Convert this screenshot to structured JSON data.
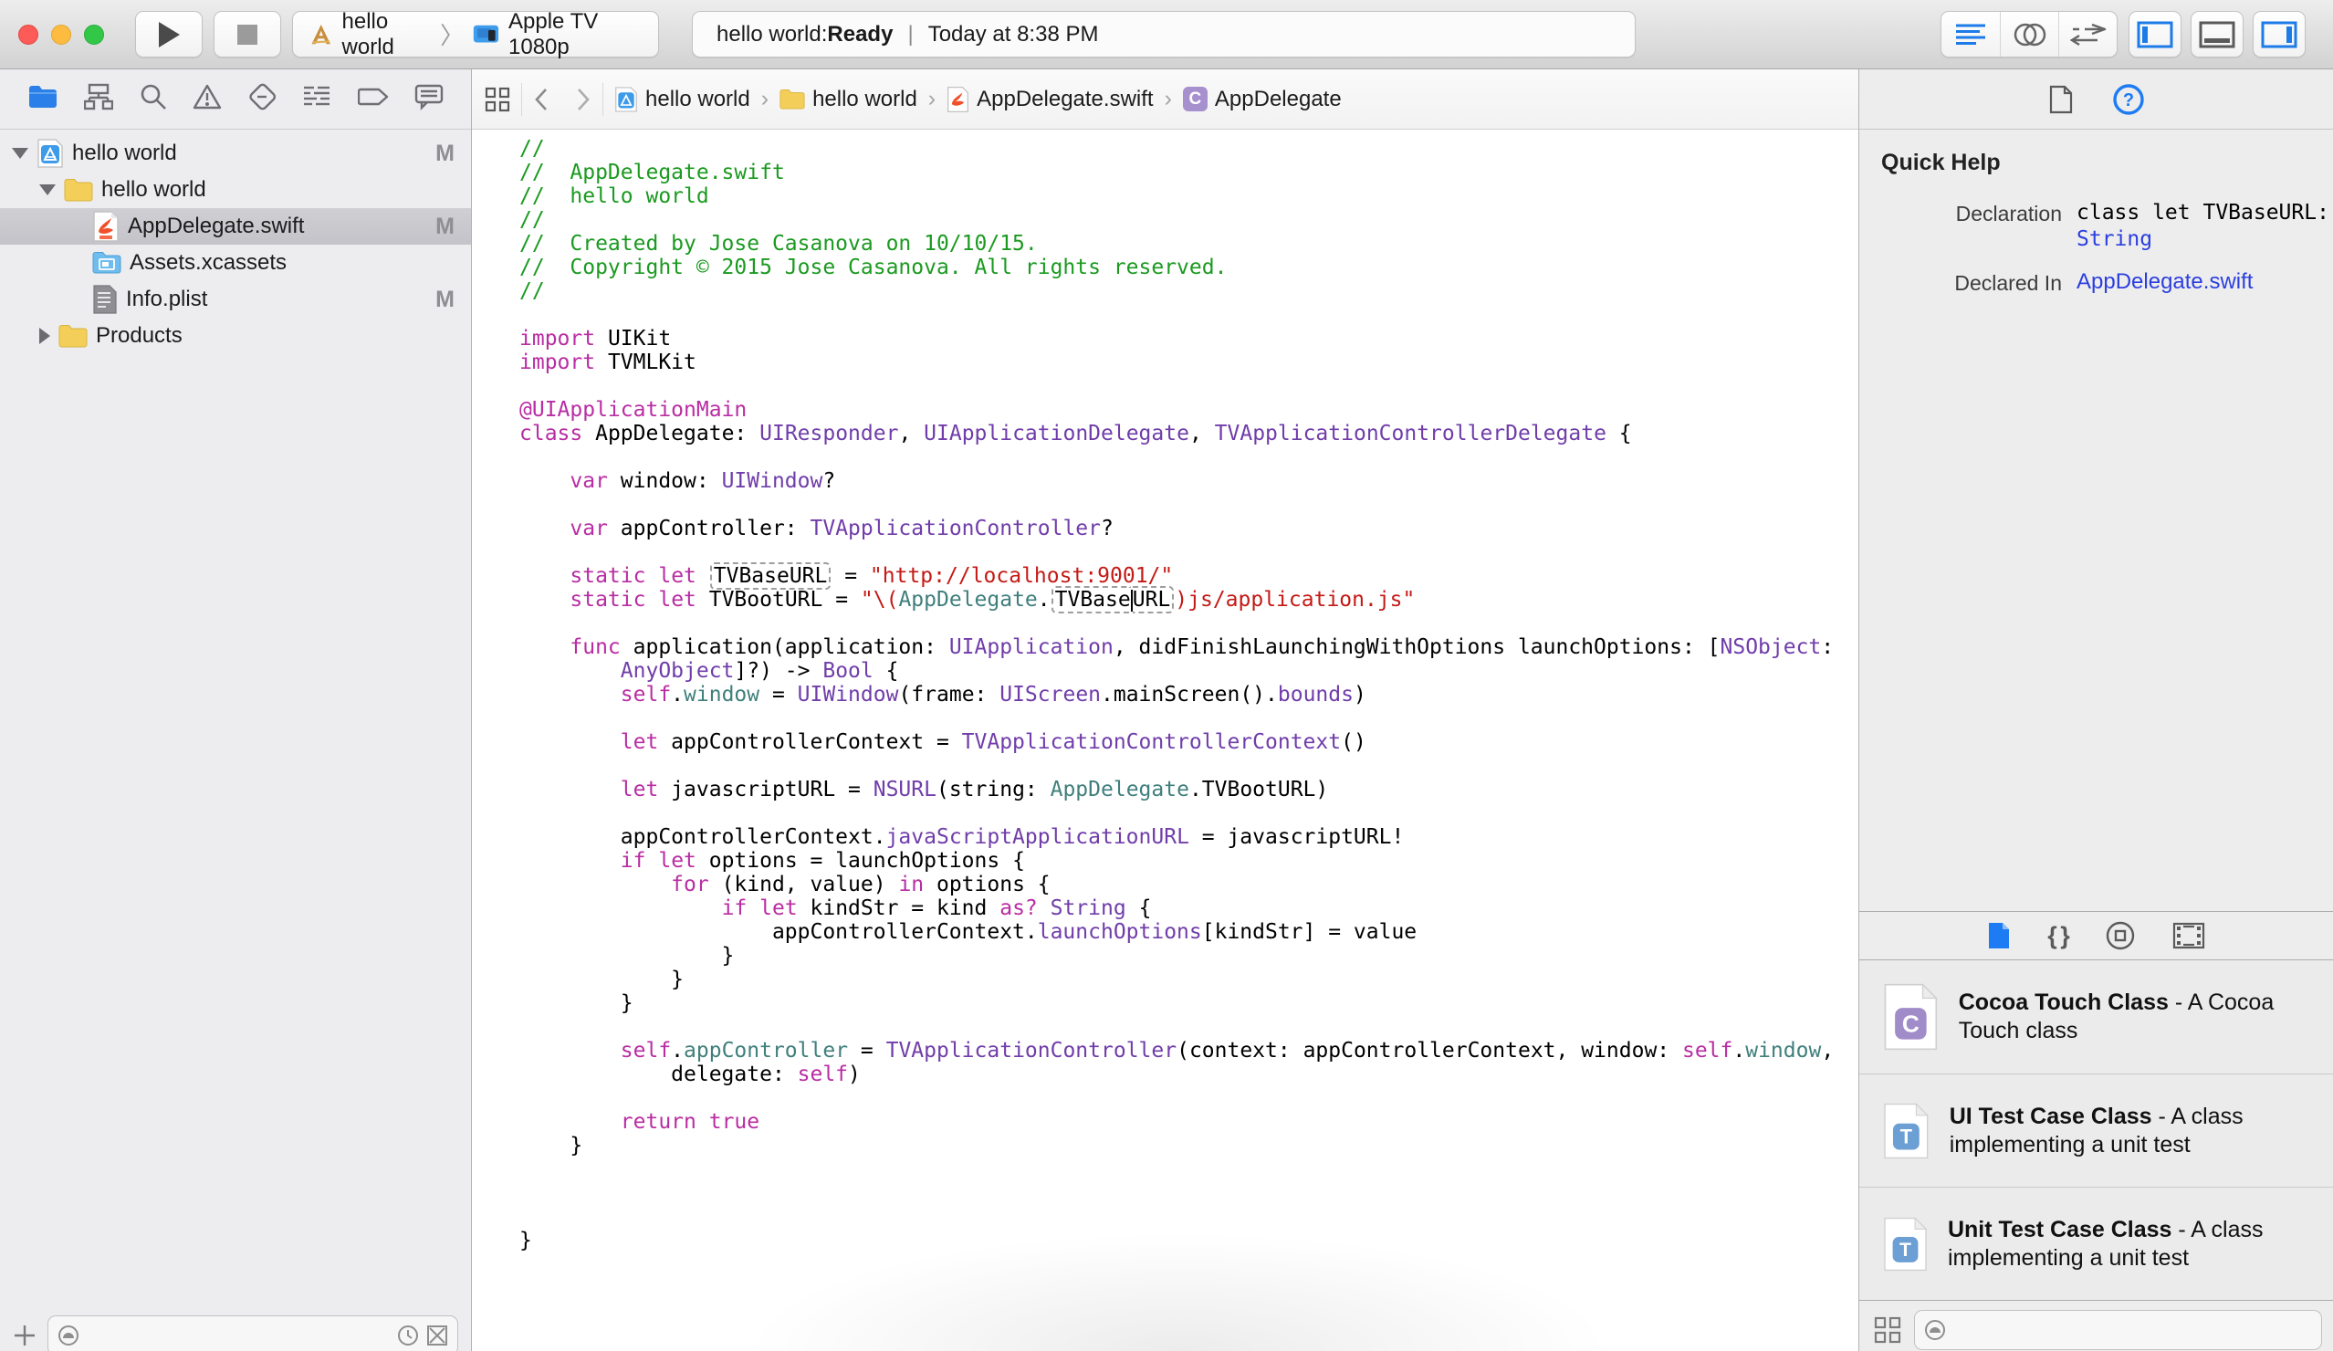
{
  "toolbar": {
    "scheme": {
      "project": "hello world",
      "sep": "〉",
      "device": "Apple TV 1080p"
    },
    "status": {
      "prefix": "hello world: ",
      "state": "Ready",
      "sep": "|",
      "time": "Today at 8:38 PM"
    }
  },
  "colors": {
    "traffic_red": "#FC5B57",
    "traffic_yellow": "#FDBC40",
    "traffic_green": "#33C748",
    "accent_blue": "#1D7BE8",
    "keyword": "#B92DA3",
    "comment": "#1B9A20",
    "string": "#C41A16",
    "type_purple": "#703DAA",
    "project_teal": "#3F7F7C"
  },
  "navigator": {
    "rows": [
      {
        "label": "hello world",
        "badge": "M",
        "icon": "project"
      },
      {
        "label": "hello world",
        "badge": "",
        "icon": "folder"
      },
      {
        "label": "AppDelegate.swift",
        "badge": "M",
        "icon": "swift"
      },
      {
        "label": "Assets.xcassets",
        "badge": "",
        "icon": "assets"
      },
      {
        "label": "Info.plist",
        "badge": "M",
        "icon": "plist"
      },
      {
        "label": "Products",
        "badge": "",
        "icon": "folder"
      }
    ]
  },
  "jumpbar": {
    "sep": "›",
    "crumbs": [
      {
        "label": "hello world"
      },
      {
        "label": "hello world"
      },
      {
        "label": "AppDelegate.swift"
      },
      {
        "label": "AppDelegate"
      }
    ],
    "c_badge": "C"
  },
  "code": {
    "lines": [
      [
        [
          "c",
          "//"
        ]
      ],
      [
        [
          "c",
          "//  AppDelegate.swift"
        ]
      ],
      [
        [
          "c",
          "//  hello world"
        ]
      ],
      [
        [
          "c",
          "//"
        ]
      ],
      [
        [
          "c",
          "//  Created by Jose Casanova on 10/10/15."
        ]
      ],
      [
        [
          "c",
          "//  Copyright © 2015 Jose Casanova. All rights reserved."
        ]
      ],
      [
        [
          "c",
          "//"
        ]
      ],
      [],
      [
        [
          "k",
          "import"
        ],
        [
          "n",
          " UIKit"
        ]
      ],
      [
        [
          "k",
          "import"
        ],
        [
          "n",
          " TVMLKit"
        ]
      ],
      [],
      [
        [
          "k",
          "@UIApplicationMain"
        ]
      ],
      [
        [
          "k",
          "class"
        ],
        [
          "n",
          " AppDelegate: "
        ],
        [
          "t",
          "UIResponder"
        ],
        [
          "n",
          ", "
        ],
        [
          "t",
          "UIApplicationDelegate"
        ],
        [
          "n",
          ", "
        ],
        [
          "t",
          "TVApplicationControllerDelegate"
        ],
        [
          "n",
          " {"
        ]
      ],
      [],
      [
        [
          "n",
          "    "
        ],
        [
          "k",
          "var"
        ],
        [
          "n",
          " window: "
        ],
        [
          "t",
          "UIWindow"
        ],
        [
          "n",
          "?"
        ]
      ],
      [],
      [
        [
          "n",
          "    "
        ],
        [
          "k",
          "var"
        ],
        [
          "n",
          " appController: "
        ],
        [
          "t",
          "TVApplicationController"
        ],
        [
          "n",
          "?"
        ]
      ],
      [],
      [
        [
          "n",
          "    "
        ],
        [
          "k",
          "static"
        ],
        [
          "n",
          " "
        ],
        [
          "k",
          "let"
        ],
        [
          "n",
          " "
        ],
        [
          "box",
          "TVBaseURL"
        ],
        [
          "n",
          " = "
        ],
        [
          "s",
          "\"http://localhost:9001/\""
        ]
      ],
      [
        [
          "n",
          "    "
        ],
        [
          "k",
          "static"
        ],
        [
          "n",
          " "
        ],
        [
          "k",
          "let"
        ],
        [
          "n",
          " TVBootURL = "
        ],
        [
          "s",
          "\"\\("
        ],
        [
          "p",
          "AppDelegate"
        ],
        [
          "n",
          "."
        ],
        [
          "boxl",
          "TVBase"
        ],
        [
          "caret",
          ""
        ],
        [
          "boxr",
          "URL"
        ],
        [
          "s",
          ")js/application.js\""
        ]
      ],
      [],
      [
        [
          "n",
          "    "
        ],
        [
          "k",
          "func"
        ],
        [
          "n",
          " application(application: "
        ],
        [
          "t",
          "UIApplication"
        ],
        [
          "n",
          ", didFinishLaunchingWithOptions launchOptions: ["
        ],
        [
          "t",
          "NSObject"
        ],
        [
          "n",
          ":"
        ]
      ],
      [
        [
          "n",
          "        "
        ],
        [
          "t",
          "AnyObject"
        ],
        [
          "n",
          "]?) -> "
        ],
        [
          "t",
          "Bool"
        ],
        [
          "n",
          " {"
        ]
      ],
      [
        [
          "n",
          "        "
        ],
        [
          "k",
          "self"
        ],
        [
          "n",
          "."
        ],
        [
          "p",
          "window"
        ],
        [
          "n",
          " = "
        ],
        [
          "t",
          "UIWindow"
        ],
        [
          "n",
          "(frame: "
        ],
        [
          "t",
          "UIScreen"
        ],
        [
          "n",
          ".mainScreen()."
        ],
        [
          "t",
          "bounds"
        ],
        [
          "n",
          ")"
        ]
      ],
      [],
      [
        [
          "n",
          "        "
        ],
        [
          "k",
          "let"
        ],
        [
          "n",
          " appControllerContext = "
        ],
        [
          "t",
          "TVApplicationControllerContext"
        ],
        [
          "n",
          "()"
        ]
      ],
      [],
      [
        [
          "n",
          "        "
        ],
        [
          "k",
          "let"
        ],
        [
          "n",
          " javascriptURL = "
        ],
        [
          "t",
          "NSURL"
        ],
        [
          "n",
          "(string: "
        ],
        [
          "p",
          "AppDelegate"
        ],
        [
          "n",
          ".TVBootURL)"
        ]
      ],
      [],
      [
        [
          "n",
          "        appControllerContext."
        ],
        [
          "t",
          "javaScriptApplicationURL"
        ],
        [
          "n",
          " = javascriptURL!"
        ]
      ],
      [
        [
          "n",
          "        "
        ],
        [
          "k",
          "if"
        ],
        [
          "n",
          " "
        ],
        [
          "k",
          "let"
        ],
        [
          "n",
          " options = launchOptions {"
        ]
      ],
      [
        [
          "n",
          "            "
        ],
        [
          "k",
          "for"
        ],
        [
          "n",
          " (kind, value) "
        ],
        [
          "k",
          "in"
        ],
        [
          "n",
          " options {"
        ]
      ],
      [
        [
          "n",
          "                "
        ],
        [
          "k",
          "if"
        ],
        [
          "n",
          " "
        ],
        [
          "k",
          "let"
        ],
        [
          "n",
          " kindStr = kind "
        ],
        [
          "k",
          "as?"
        ],
        [
          "n",
          " "
        ],
        [
          "t",
          "String"
        ],
        [
          "n",
          " {"
        ]
      ],
      [
        [
          "n",
          "                    appControllerContext."
        ],
        [
          "t",
          "launchOptions"
        ],
        [
          "n",
          "[kindStr] = value"
        ]
      ],
      [
        [
          "n",
          "                }"
        ]
      ],
      [
        [
          "n",
          "            }"
        ]
      ],
      [
        [
          "n",
          "        }"
        ]
      ],
      [],
      [
        [
          "n",
          "        "
        ],
        [
          "k",
          "self"
        ],
        [
          "n",
          "."
        ],
        [
          "p",
          "appController"
        ],
        [
          "n",
          " = "
        ],
        [
          "t",
          "TVApplicationController"
        ],
        [
          "n",
          "(context: appControllerContext, window: "
        ],
        [
          "k",
          "self"
        ],
        [
          "n",
          "."
        ],
        [
          "p",
          "window"
        ],
        [
          "n",
          ","
        ]
      ],
      [
        [
          "n",
          "            delegate: "
        ],
        [
          "k",
          "self"
        ],
        [
          "n",
          ")"
        ]
      ],
      [],
      [
        [
          "n",
          "        "
        ],
        [
          "k",
          "return"
        ],
        [
          "n",
          " "
        ],
        [
          "k",
          "true"
        ]
      ],
      [
        [
          "n",
          "    }"
        ]
      ],
      [],
      [],
      [],
      [
        [
          "n",
          "}"
        ]
      ]
    ]
  },
  "quickhelp": {
    "title": "Quick Help",
    "declaration_label": "Declaration",
    "declaration_line1": "class let TVBaseURL:",
    "declaration_line2": "String",
    "declared_in_label": "Declared In",
    "declared_in_value": "AppDelegate.swift"
  },
  "library": {
    "snippet_glyph": "{ }",
    "items": [
      {
        "badge": "C",
        "title": "Cocoa Touch Class",
        "desc": " - A Cocoa Touch class"
      },
      {
        "badge": "T",
        "title": "UI Test Case Class",
        "desc": " - A class implementing a unit test"
      },
      {
        "badge": "T",
        "title": "Unit Test Case Class",
        "desc": " - A class implementing a unit test"
      }
    ]
  }
}
